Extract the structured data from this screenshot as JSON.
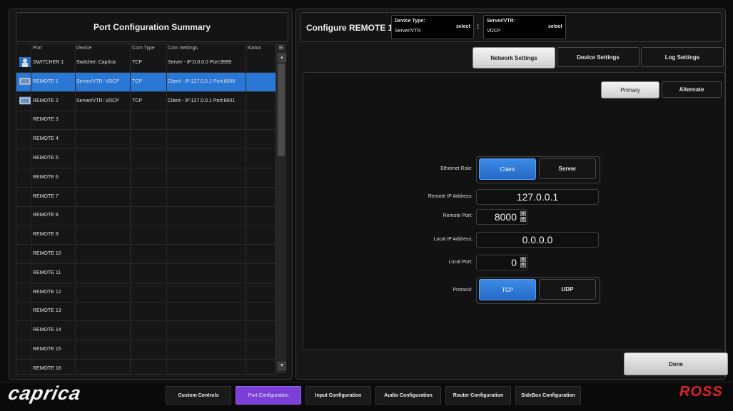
{
  "left": {
    "title": "Port Configuration Summary",
    "columns": [
      "Port",
      "Device",
      "Com Type",
      "Com Settings",
      "Status"
    ],
    "rows": [
      {
        "port": "SWITCHER 1",
        "device": "Switcher: Caprica",
        "com_type": "TCP",
        "com_settings": "Server - IP:0.0.0.0 Port:9999",
        "icon": "person-icon",
        "selected": false
      },
      {
        "port": "REMOTE 1",
        "device": "Server/VTR: VDCP",
        "com_type": "TCP",
        "com_settings": "Client - IP:127.0.0.1 Port:8000",
        "icon": "vtr-icon",
        "selected": true
      },
      {
        "port": "REMOTE 2",
        "device": "Server/VTR: VDCP",
        "com_type": "TCP",
        "com_settings": "Client - IP:127.0.0.1 Port:8001",
        "icon": "vtr-icon",
        "selected": false
      },
      {
        "port": "REMOTE 3",
        "device": "",
        "com_type": "",
        "com_settings": "",
        "icon": "",
        "selected": false
      },
      {
        "port": "REMOTE 4",
        "device": "",
        "com_type": "",
        "com_settings": "",
        "icon": "",
        "selected": false
      },
      {
        "port": "REMOTE 5",
        "device": "",
        "com_type": "",
        "com_settings": "",
        "icon": "",
        "selected": false
      },
      {
        "port": "REMOTE 6",
        "device": "",
        "com_type": "",
        "com_settings": "",
        "icon": "",
        "selected": false
      },
      {
        "port": "REMOTE 7",
        "device": "",
        "com_type": "",
        "com_settings": "",
        "icon": "",
        "selected": false
      },
      {
        "port": "REMOTE 8",
        "device": "",
        "com_type": "",
        "com_settings": "",
        "icon": "",
        "selected": false
      },
      {
        "port": "REMOTE 9",
        "device": "",
        "com_type": "",
        "com_settings": "",
        "icon": "",
        "selected": false
      },
      {
        "port": "REMOTE 10",
        "device": "",
        "com_type": "",
        "com_settings": "",
        "icon": "",
        "selected": false
      },
      {
        "port": "REMOTE 11",
        "device": "",
        "com_type": "",
        "com_settings": "",
        "icon": "",
        "selected": false
      },
      {
        "port": "REMOTE 12",
        "device": "",
        "com_type": "",
        "com_settings": "",
        "icon": "",
        "selected": false
      },
      {
        "port": "REMOTE 13",
        "device": "",
        "com_type": "",
        "com_settings": "",
        "icon": "",
        "selected": false
      },
      {
        "port": "REMOTE 14",
        "device": "",
        "com_type": "",
        "com_settings": "",
        "icon": "",
        "selected": false
      },
      {
        "port": "REMOTE 15",
        "device": "",
        "com_type": "",
        "com_settings": "",
        "icon": "",
        "selected": false
      },
      {
        "port": "REMOTE 16",
        "device": "",
        "com_type": "",
        "com_settings": "",
        "icon": "",
        "selected": false
      }
    ]
  },
  "right": {
    "title": "Configure REMOTE 1 :",
    "device_type": {
      "label": "Device Type:",
      "value": "Server/VTR",
      "select": "select"
    },
    "separator": ":",
    "device_sub": {
      "label": "Server/VTR:",
      "value": "VDCP",
      "select": "select"
    },
    "tabs": [
      "Network Settings",
      "Device Settings",
      "Log Settings"
    ],
    "active_tab": 0,
    "toggle": [
      "Primary",
      "Alternate"
    ],
    "ethernet_role": {
      "label": "Ethernet Role:",
      "options": [
        "Client",
        "Server"
      ],
      "selected": "Client"
    },
    "remote_ip": {
      "label": "Remote IP Address:",
      "value": "127.0.0.1"
    },
    "remote_port": {
      "label": "Remote Port:",
      "value": "8000"
    },
    "local_ip": {
      "label": "Local IP Address:",
      "value": "0.0.0.0"
    },
    "local_port": {
      "label": "Local Port:",
      "value": "0"
    },
    "protocol": {
      "label": "Protocol:",
      "options": [
        "TCP",
        "UDP"
      ],
      "selected": "TCP"
    },
    "done": "Done"
  },
  "bottom": {
    "logo": "caprica",
    "nav": [
      "Custom Controls",
      "Port Configuration",
      "Input Configuration",
      "Audio Configuration",
      "Router Configuration",
      "SideBox Configuration"
    ],
    "active": "Port Configuration",
    "brand": "ROSS"
  },
  "colors": {
    "selected_row": "#2a78d6",
    "active_nav": "#7b3fd8",
    "brand_red": "#e0202a"
  }
}
